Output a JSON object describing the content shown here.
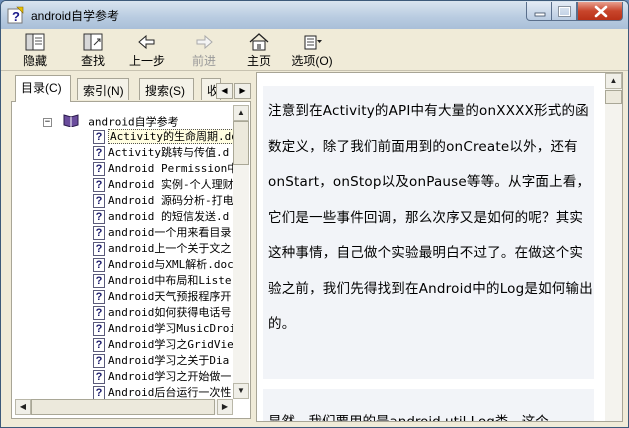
{
  "window": {
    "title": "android自学参考",
    "app_icon": "help-question-icon"
  },
  "toolbar": {
    "items": [
      {
        "label": "隐藏",
        "icon": "hide-pane-icon",
        "enabled": true
      },
      {
        "label": "查找",
        "icon": "find-icon",
        "enabled": true
      },
      {
        "label": "上一步",
        "icon": "back-arrow-icon",
        "enabled": true
      },
      {
        "label": "前进",
        "icon": "forward-arrow-icon",
        "enabled": false
      },
      {
        "label": "主页",
        "icon": "home-icon",
        "enabled": true
      },
      {
        "label": "选项(O)",
        "icon": "options-icon",
        "enabled": true
      }
    ]
  },
  "nav": {
    "tabs": [
      {
        "label": "目录(C)",
        "active": true
      },
      {
        "label": "索引(N)",
        "active": false
      },
      {
        "label": "搜索(S)",
        "active": false
      },
      {
        "label": "收",
        "active": false
      }
    ],
    "root": {
      "label": "android自学参考",
      "expanded": true
    },
    "items": [
      "Activity的生命周期.doc",
      "Activity跳转与传值.d",
      "Android Permission中",
      "Android 实例-个人理财",
      "Android 源码分析-打电",
      "android 的短信发送.d",
      "android一个用来看目录",
      "android上一个关于文之",
      "Android与XML解析.doc",
      "Android中布局和Liste",
      "Android天气预报程序开",
      "android如何获得电话号",
      "Android学习MusicDroid",
      "Android学习之GridVie",
      "Android学习之关于Dia",
      "Android学习之开始做一",
      "Android后台运行一次性"
    ],
    "selected_index": 0
  },
  "content": {
    "paragraph1": "注意到在Activity的API中有大量的onXXXX形式的函数定义，除了我们前面用到的onCreate以外，还有onStart，onStop以及onPause等等。从字面上看，它们是一些事件回调，那么次序又是如何的呢？其实这种事情，自己做个实验最明白不过了。在做这个实验之前，我们先得找到在Android中的Log是如何输出的。",
    "paragraph2": "显然，我们要用的是android.util.Log类，这个"
  }
}
